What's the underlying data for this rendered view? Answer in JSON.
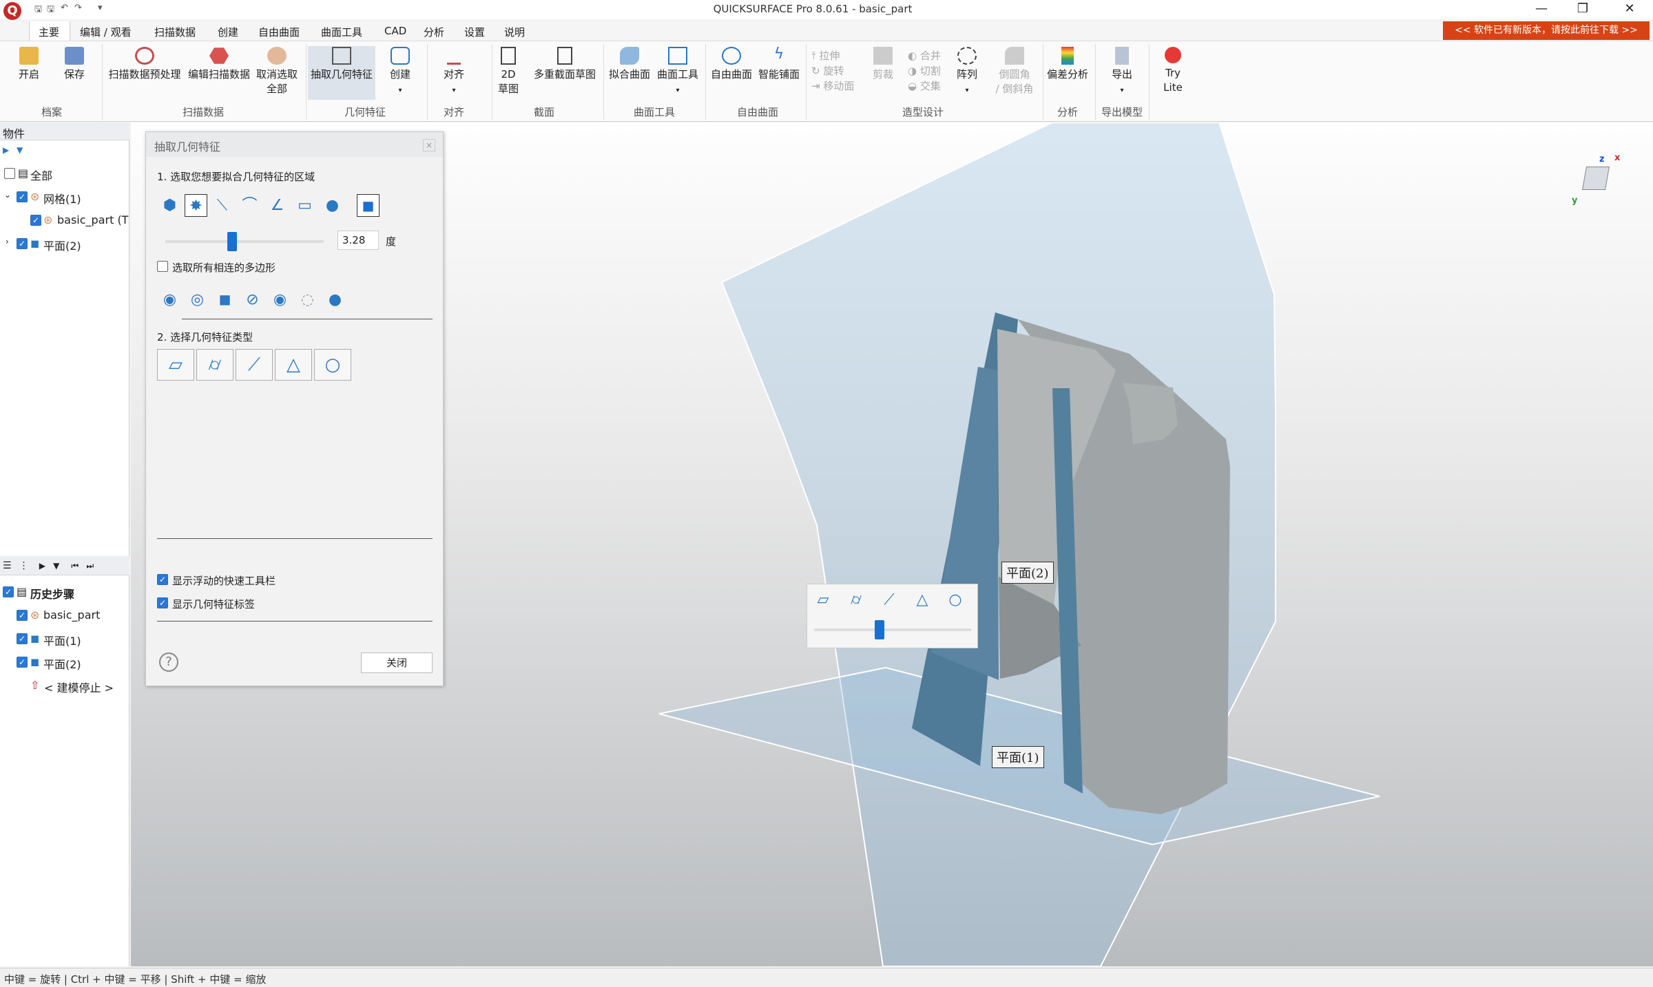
{
  "window": {
    "title": "QUICKSURFACE Pro 8.0.61 - basic_part",
    "logo": "Q"
  },
  "menu": [
    "主要",
    "编辑 / 观看",
    "扫描数据",
    "创建",
    "自由曲面",
    "曲面工具",
    "CAD",
    "分析",
    "设置",
    "说明"
  ],
  "update_banner": "<< 软件已有新版本，请按此前往下载 >>",
  "ribbon": {
    "open": "开启",
    "save": "保存",
    "grp_file": "档案",
    "scan_pre": "扫描数据预处理",
    "scan_edit": "编辑扫描数据",
    "deselect": "取消选取",
    "deselect2": "全部",
    "grp_scan": "扫描数据",
    "extract": "抽取几何特征",
    "create": "创建",
    "grp_geom": "几何特征",
    "align": "对齐",
    "grp_align": "对齐",
    "sketch2d": "2D",
    "sketch2d_b": "草图",
    "multisec": "多重截面草图",
    "grp_section": "截面",
    "fitsurf": "拟合曲面",
    "surftool": "曲面工具",
    "grp_surftool": "曲面工具",
    "freesurf": "自由曲面",
    "smartpave": "智能铺面",
    "grp_free": "自由曲面",
    "extrude": "拉伸",
    "revolve": "旋转",
    "movesurf": "移动面",
    "trim": "剪裁",
    "merge": "合并",
    "cut": "切割",
    "intersect": "交集",
    "pattern": "阵列",
    "fillet": "倒圆角",
    "chamfer": "/ 倒斜角",
    "grp_model": "造型设计",
    "deviation": "偏差分析",
    "grp_analysis": "分析",
    "export": "导出",
    "grp_export": "导出模型",
    "try": "Try",
    "lite": "Lite"
  },
  "objects": {
    "header": "物件",
    "all": "全部",
    "mesh": "网格(1)",
    "part": "basic_part (T",
    "plane": "平面(2)"
  },
  "history": {
    "root": "历史步骤",
    "items": [
      "basic_part",
      "平面(1)",
      "平面(2)"
    ],
    "stop": "< 建模停止 >"
  },
  "dialog": {
    "title": "抽取几何特征",
    "step1": "1. 选取您想要拟合几何特征的区域",
    "angle": "3.28",
    "angle_unit": "度",
    "select_all": "选取所有相连的多边形",
    "step2": "2. 选择几何特征类型",
    "show_toolbar": "显示浮动的快速工具栏",
    "show_labels": "显示几何特征标签",
    "close": "关闭",
    "help": "?"
  },
  "viewport": {
    "label_plane2": "平面(2)",
    "label_plane1": "平面(1)",
    "triad": {
      "x": "x",
      "y": "y",
      "z": "z"
    }
  },
  "status": "中键 = 旋转 | Ctrl + 中键 = 平移 | Shift + 中键 = 缩放"
}
